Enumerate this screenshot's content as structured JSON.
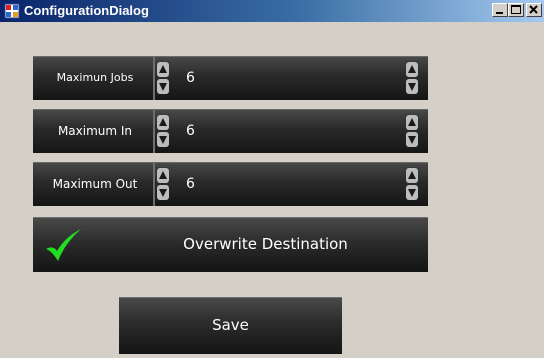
{
  "window": {
    "title": "ConfigurationDialog",
    "controls": {
      "minimize_icon": "minimize-icon",
      "maximize_icon": "maximize-icon",
      "close_icon": "close-icon"
    }
  },
  "settings": {
    "max_jobs": {
      "label": "Maximun Jobs",
      "value": "6"
    },
    "max_in": {
      "label": "Maximum In",
      "value": "6"
    },
    "max_out": {
      "label": "Maximum Out",
      "value": "6"
    }
  },
  "overwrite": {
    "label": "Overwrite Destination",
    "checked": true,
    "check_color": "#22dd22"
  },
  "save": {
    "label": "Save"
  },
  "colors": {
    "titlebar_start": "#0a246a",
    "titlebar_end": "#a6caf0",
    "panel_bg": "#d4d0c8",
    "control_bg": "#2a2a2a"
  }
}
